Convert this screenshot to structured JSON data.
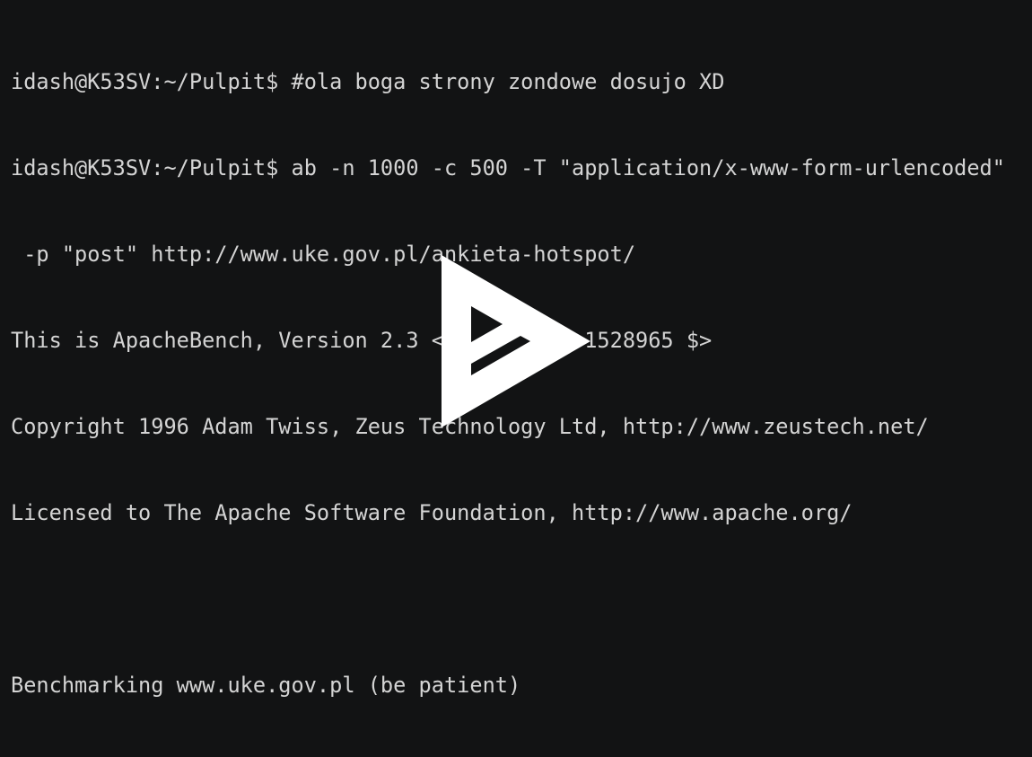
{
  "terminal": {
    "lines": [
      "idash@K53SV:~/Pulpit$ #ola boga strony zondowe dosujo XD",
      "idash@K53SV:~/Pulpit$ ab -n 1000 -c 500 -T \"application/x-www-form-urlencoded\"",
      " -p \"post\" http://www.uke.gov.pl/ankieta-hotspot/",
      "This is ApacheBench, Version 2.3 <$Revision: 1528965 $>",
      "Copyright 1996 Adam Twiss, Zeus Technology Ltd, http://www.zeustech.net/",
      "Licensed to The Apache Software Foundation, http://www.apache.org/",
      "",
      "Benchmarking www.uke.gov.pl (be patient)"
    ]
  },
  "player": {
    "overlay_icon": "asciinema-play-icon"
  },
  "colors": {
    "background": "#121314",
    "text": "#d4d4d4",
    "icon": "#ffffff"
  }
}
